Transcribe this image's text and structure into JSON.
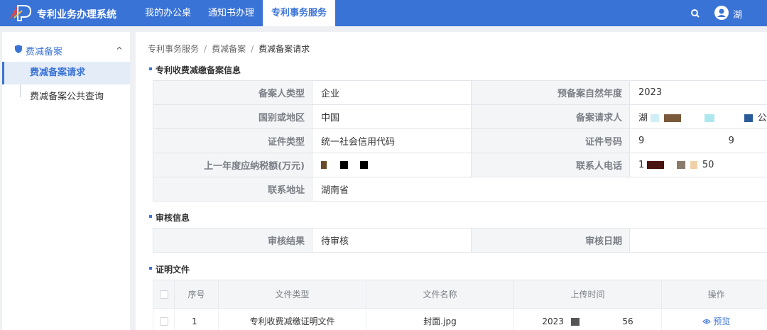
{
  "app": {
    "title": "专利业务办理系统",
    "user": "湖",
    "colors": {
      "primary": "#3a73d6",
      "label_bg": "#f4f5f7",
      "border": "#e2e5ea"
    }
  },
  "nav": {
    "items": [
      "我的办公桌",
      "通知书办理",
      "专利事务服务"
    ],
    "active": "专利事务服务"
  },
  "icons": {
    "logo": "patent-logo",
    "search": "search-icon",
    "user": "user-icon",
    "group": "shield-icon",
    "chevron": "chevron-up-icon",
    "preview": "eye-icon"
  },
  "sidebar": {
    "group": "费减备案",
    "items": [
      "费减备案请求",
      "费减备案公共查询"
    ],
    "active": "费减备案请求"
  },
  "breadcrumb": [
    "专利事务服务",
    "费减备案",
    "费减备案请求"
  ],
  "sections": {
    "info": "专利收费减缴备案信息",
    "review": "审核信息",
    "files": "证明文件"
  },
  "info": {
    "filer_type_label": "备案人类型",
    "filer_type": "企业",
    "year_label": "预备案自然年度",
    "year": "2023",
    "country_label": "国别或地区",
    "country": "中国",
    "requester_label": "备案请求人",
    "requester_visible": "湖",
    "requester_tail": "公司",
    "id_type_label": "证件类型",
    "id_type": "统一社会信用代码",
    "id_no_label": "证件号码",
    "id_no_head": "9",
    "id_no_tail": "9",
    "tax_label": "上一年度应纳税额(万元)",
    "phone_label": "联系人电话",
    "phone_head": "1",
    "phone_tail": "50",
    "address_label": "联系地址",
    "address": "湖南省"
  },
  "review": {
    "result_label": "审核结果",
    "result": "待审核",
    "date_label": "审核日期",
    "date": ""
  },
  "files": {
    "headers": [
      "序号",
      "文件类型",
      "文件名称",
      "上传时间",
      "操作"
    ],
    "rows": [
      {
        "no": "1",
        "type": "专利收费减缴证明文件",
        "name": "封面.jpg",
        "time_head": "2023",
        "time_tail": "56",
        "action": "预览"
      }
    ]
  }
}
